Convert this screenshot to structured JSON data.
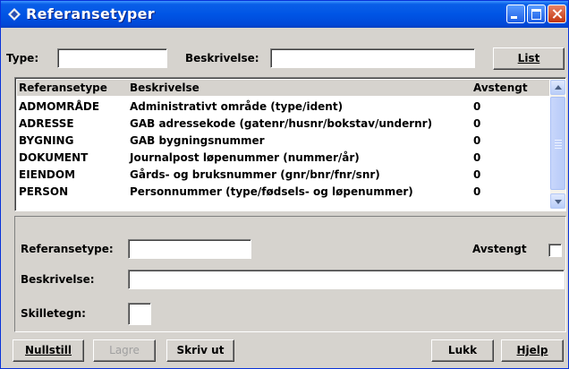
{
  "window": {
    "title": "Referansetyper"
  },
  "filter": {
    "type_label": "Type:",
    "type_value": "",
    "desc_label": "Beskrivelse:",
    "desc_value": "",
    "list_button": "List"
  },
  "table": {
    "columns": [
      "Referansetype",
      "Beskrivelse",
      "Avstengt"
    ],
    "rows": [
      {
        "type": "ADMOMRÅDE",
        "desc": "Administrativt område (type/ident)",
        "closed": "0"
      },
      {
        "type": "ADRESSE",
        "desc": "GAB adressekode (gatenr/husnr/bokstav/undernr)",
        "closed": "0"
      },
      {
        "type": "BYGNING",
        "desc": "GAB bygningsnummer",
        "closed": "0"
      },
      {
        "type": "DOKUMENT",
        "desc": "Journalpost løpenummer (nummer/år)",
        "closed": "0"
      },
      {
        "type": "EIENDOM",
        "desc": "Gårds- og bruksnummer (gnr/bnr/fnr/snr)",
        "closed": "0"
      },
      {
        "type": "PERSON",
        "desc": "Personnummer (type/fødsels- og løpenummer)",
        "closed": "0"
      }
    ]
  },
  "detail": {
    "reftype_label": "Referansetype:",
    "reftype_value": "",
    "closed_label": "Avstengt",
    "desc_label": "Beskrivelse:",
    "desc_value": "",
    "sep_label": "Skilletegn:",
    "sep_value": ""
  },
  "buttons": {
    "reset": "Nullstill",
    "save": "Lagre",
    "print": "Skriv ut",
    "close": "Lukk",
    "help": "Hjelp"
  },
  "colors": {
    "titlebar": "#0055e5",
    "face": "#d6d3ce"
  }
}
